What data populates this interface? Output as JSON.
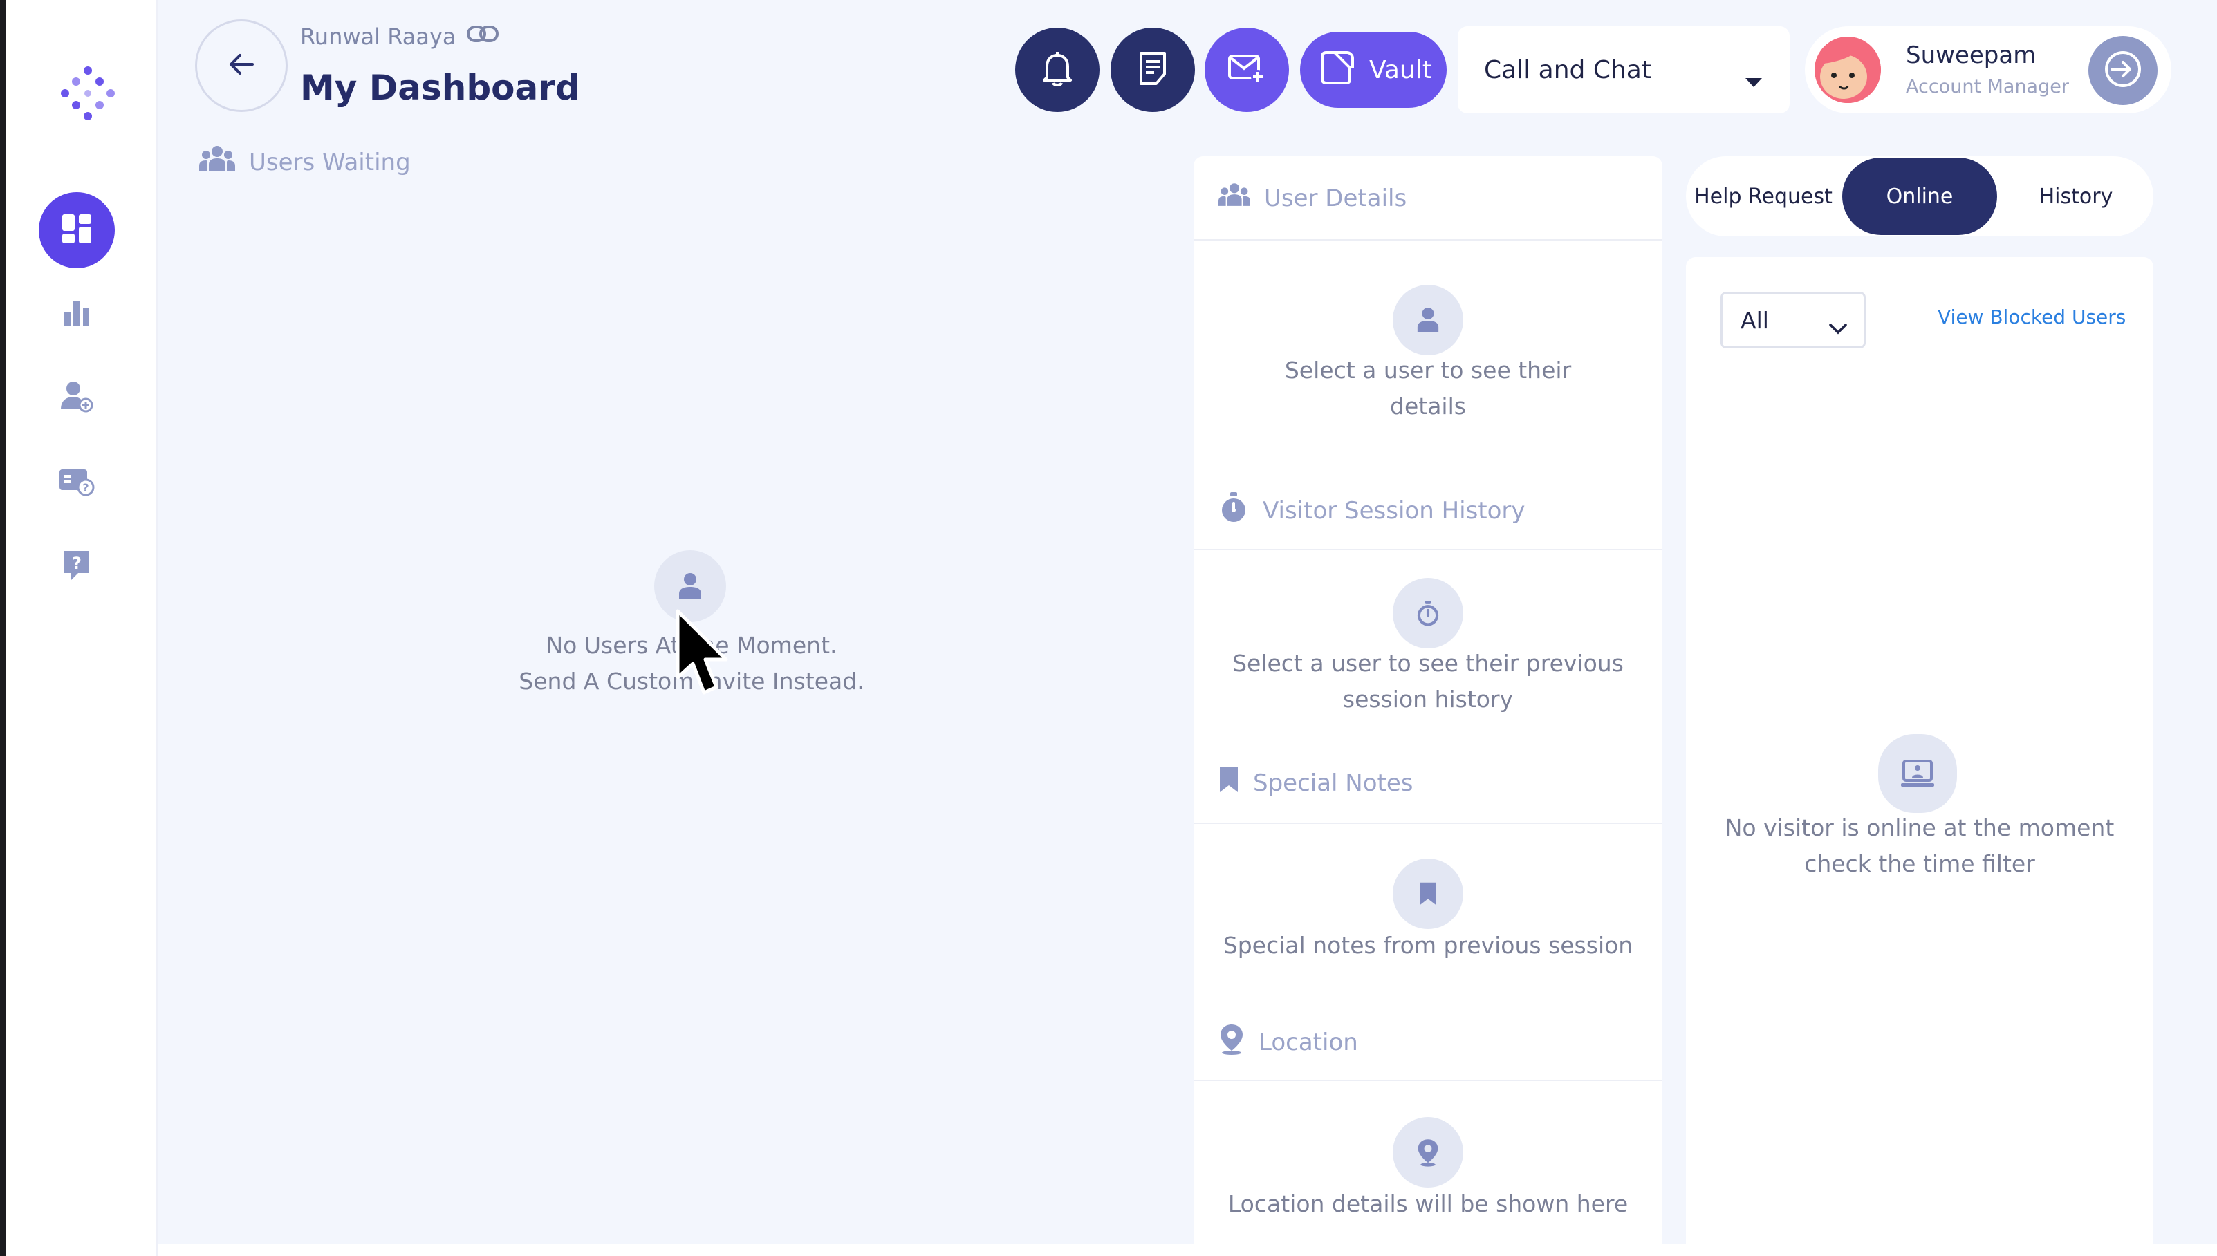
{
  "header": {
    "org_name": "Runwal Raaya",
    "page_title": "My Dashboard",
    "vault_label": "Vault",
    "mode_value": "Call and Chat",
    "user": {
      "name": "Suweepam",
      "role": "Account Manager"
    }
  },
  "sidebar": {
    "items": [
      {
        "icon": "dashboard-icon",
        "active": true
      },
      {
        "icon": "bar-chart-icon",
        "active": false
      },
      {
        "icon": "user-add-icon",
        "active": false
      },
      {
        "icon": "ticket-help-icon",
        "active": false
      },
      {
        "icon": "help-icon",
        "active": false
      }
    ]
  },
  "waiting": {
    "title": "Users Waiting",
    "empty_line1": "No Users At The Moment.",
    "empty_line2": "Send A Custom Invite Instead."
  },
  "details": {
    "user_details_title": "User Details",
    "user_details_empty_line1": "Select a user to see their",
    "user_details_empty_line2": "details",
    "session_title": "Visitor Session History",
    "session_empty_line1": "Select a user to see their previous",
    "session_empty_line2": "session history",
    "notes_title": "Special Notes",
    "notes_empty": "Special notes from previous session",
    "location_title": "Location",
    "location_empty": "Location details will be shown here"
  },
  "visitors": {
    "tabs": [
      "Help Request",
      "Online",
      "History"
    ],
    "active_tab": "Online",
    "filter_value": "All",
    "blocked_link": "View Blocked Users",
    "empty_line1": "No visitor is online at the moment",
    "empty_line2": "check the time filter"
  },
  "colors": {
    "accent": "#5b44e8",
    "dark": "#28306b",
    "background": "#f3f6fd",
    "link": "#2a7fe0"
  }
}
